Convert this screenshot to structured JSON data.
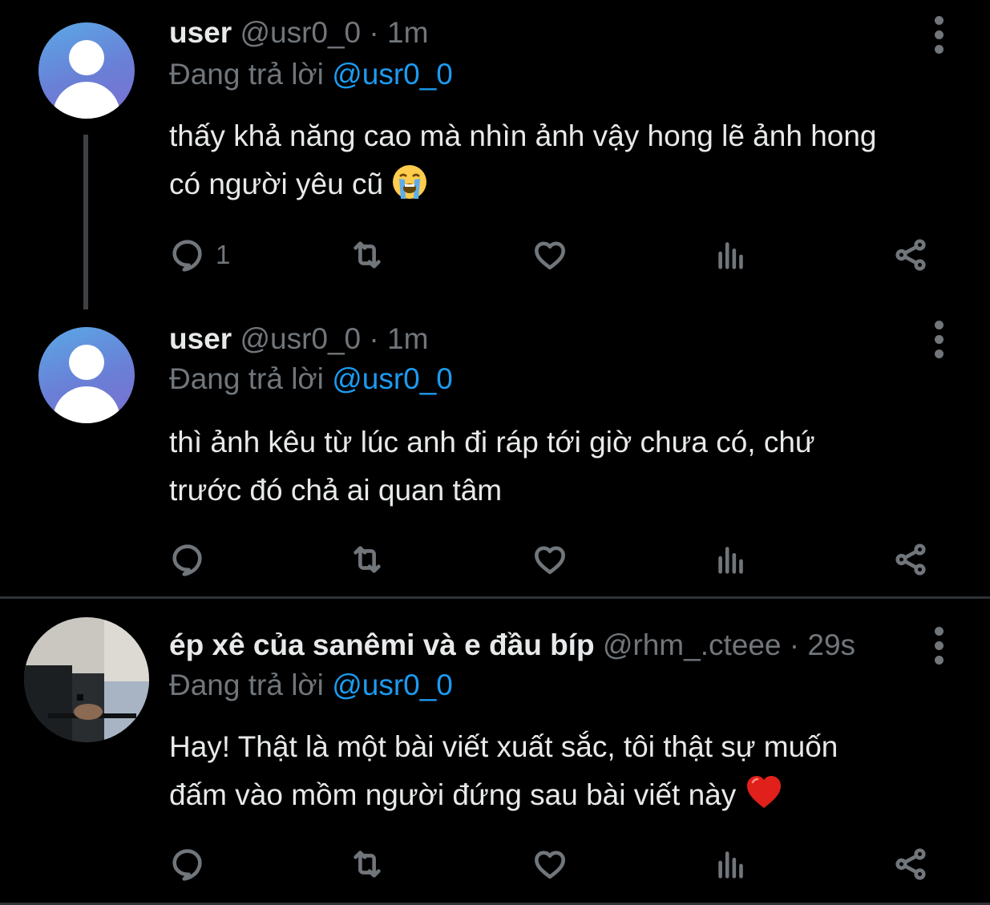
{
  "tweets": [
    {
      "name": "user",
      "handle": "@usr0_0",
      "separator": "·",
      "time": "1m",
      "replying_prefix": "Đang trả lời",
      "replying_to": "@usr0_0",
      "text_line1": "thấy khả năng cao mà nhìn ảnh vậy hong lẽ ảnh hong",
      "text_line2": "có người yêu cũ",
      "emoji": "loudly-crying-face-emoji",
      "reply_count": "1",
      "avatar": "default-avatar"
    },
    {
      "name": "user",
      "handle": "@usr0_0",
      "separator": "·",
      "time": "1m",
      "replying_prefix": "Đang trả lời",
      "replying_to": "@usr0_0",
      "text_line1": "thì ảnh kêu từ lúc anh đi ráp tới giờ chưa có, chứ",
      "text_line2": "trước đó chả ai quan tâm",
      "reply_count": "",
      "avatar": "default-avatar"
    },
    {
      "name": "ép xê của sanêmi và e đầu bíp",
      "handle": "@rhm_.cteee",
      "separator": "·",
      "time": "29s",
      "replying_prefix": "Đang trả lời",
      "replying_to": "@usr0_0",
      "text_line1": "Hay! Thật là một bài viết xuất sắc, tôi thật sự muốn",
      "text_line2": "đấm vào mồm người đứng sau bài viết này",
      "emoji": "red-heart-emoji",
      "reply_count": "",
      "avatar": "photo-avatar-holding-hands"
    }
  ],
  "colors": {
    "background": "#000000",
    "text": "#e7e9ea",
    "muted": "#71767b",
    "accent": "#1d9bf0",
    "divider": "#2f3336"
  },
  "icons": [
    "reply-icon",
    "retweet-icon",
    "like-icon",
    "views-icon",
    "share-icon",
    "more-icon"
  ]
}
